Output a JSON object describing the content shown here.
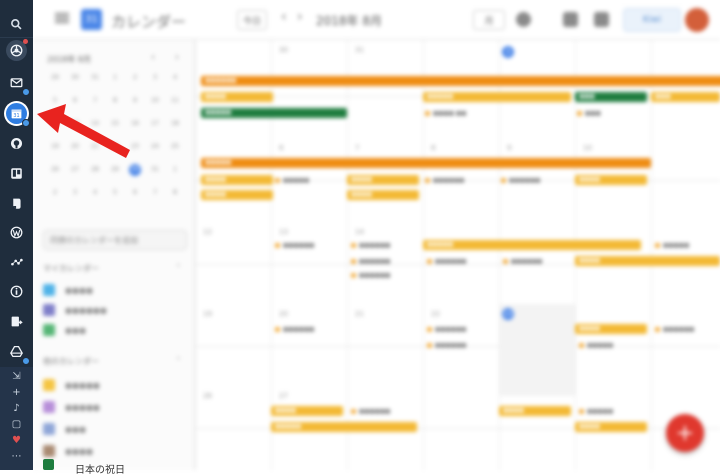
{
  "rail": {
    "items": [
      {
        "name": "search-icon"
      },
      {
        "name": "chrome-icon"
      },
      {
        "name": "mail-icon"
      },
      {
        "name": "calendar-icon",
        "active": true
      },
      {
        "name": "github-icon"
      },
      {
        "name": "trello-icon"
      },
      {
        "name": "evernote-icon"
      },
      {
        "name": "wordpress-icon"
      },
      {
        "name": "analytics-icon"
      },
      {
        "name": "info-icon"
      },
      {
        "name": "share-icon"
      },
      {
        "name": "drive-icon"
      }
    ],
    "bottom": [
      "move-icon",
      "plus-icon",
      "bell-icon",
      "doc-icon",
      "heart-icon",
      "more-icon"
    ],
    "accent": "#2f7de1",
    "background": "#1f2d3d"
  },
  "app": {
    "title": "カレンダー",
    "today_label": "今日",
    "month_label": "2018年 8月",
    "view_label": "月",
    "pro_label": "Kiwi",
    "sidebar_my_calendars": "マイカレンダー",
    "sidebar_other_calendars": "他のカレンダー",
    "search_placeholder": "同僚のカレンダーを追加",
    "holiday_calendar": "日本の祝日"
  },
  "colors": {
    "event_orange": "#ef8c12",
    "event_yellow": "#f3b934",
    "event_green": "#1e7d3f",
    "fab_red": "#e0382e",
    "arrow_red": "#e8231f"
  }
}
